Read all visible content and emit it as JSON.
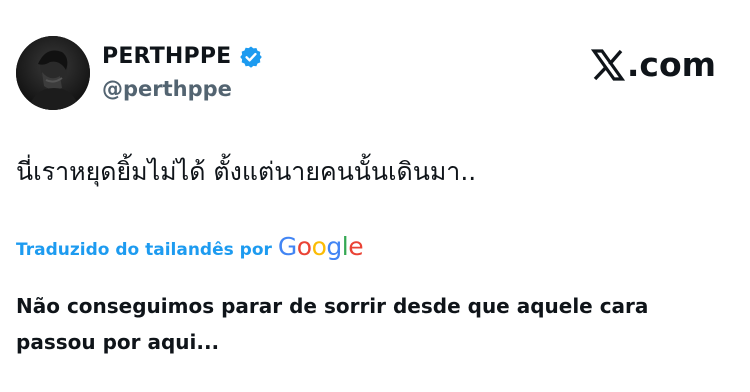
{
  "author": {
    "display_name": "PERTHPPE",
    "handle": "@perthppe",
    "verified_icon": "verified-badge-icon",
    "avatar_icon": "avatar-photo"
  },
  "brand": {
    "logo_icon": "x-logo-icon",
    "text": ".com"
  },
  "tweet": {
    "text": "นี่เราหยุดยิ้มไม่ได้ ตั้งแต่นายคนนั้นเดินมา.."
  },
  "translation": {
    "label": "Traduzido do tailandês por",
    "provider": "Google",
    "text": "Não conseguimos parar de sorrir desde que aquele cara passou por aqui..."
  },
  "colors": {
    "accent": "#1d9bf0",
    "text": "#0f1419",
    "muted": "#536471",
    "google_blue": "#4285F4",
    "google_red": "#EA4335",
    "google_yellow": "#FBBC05",
    "google_green": "#34A853"
  }
}
